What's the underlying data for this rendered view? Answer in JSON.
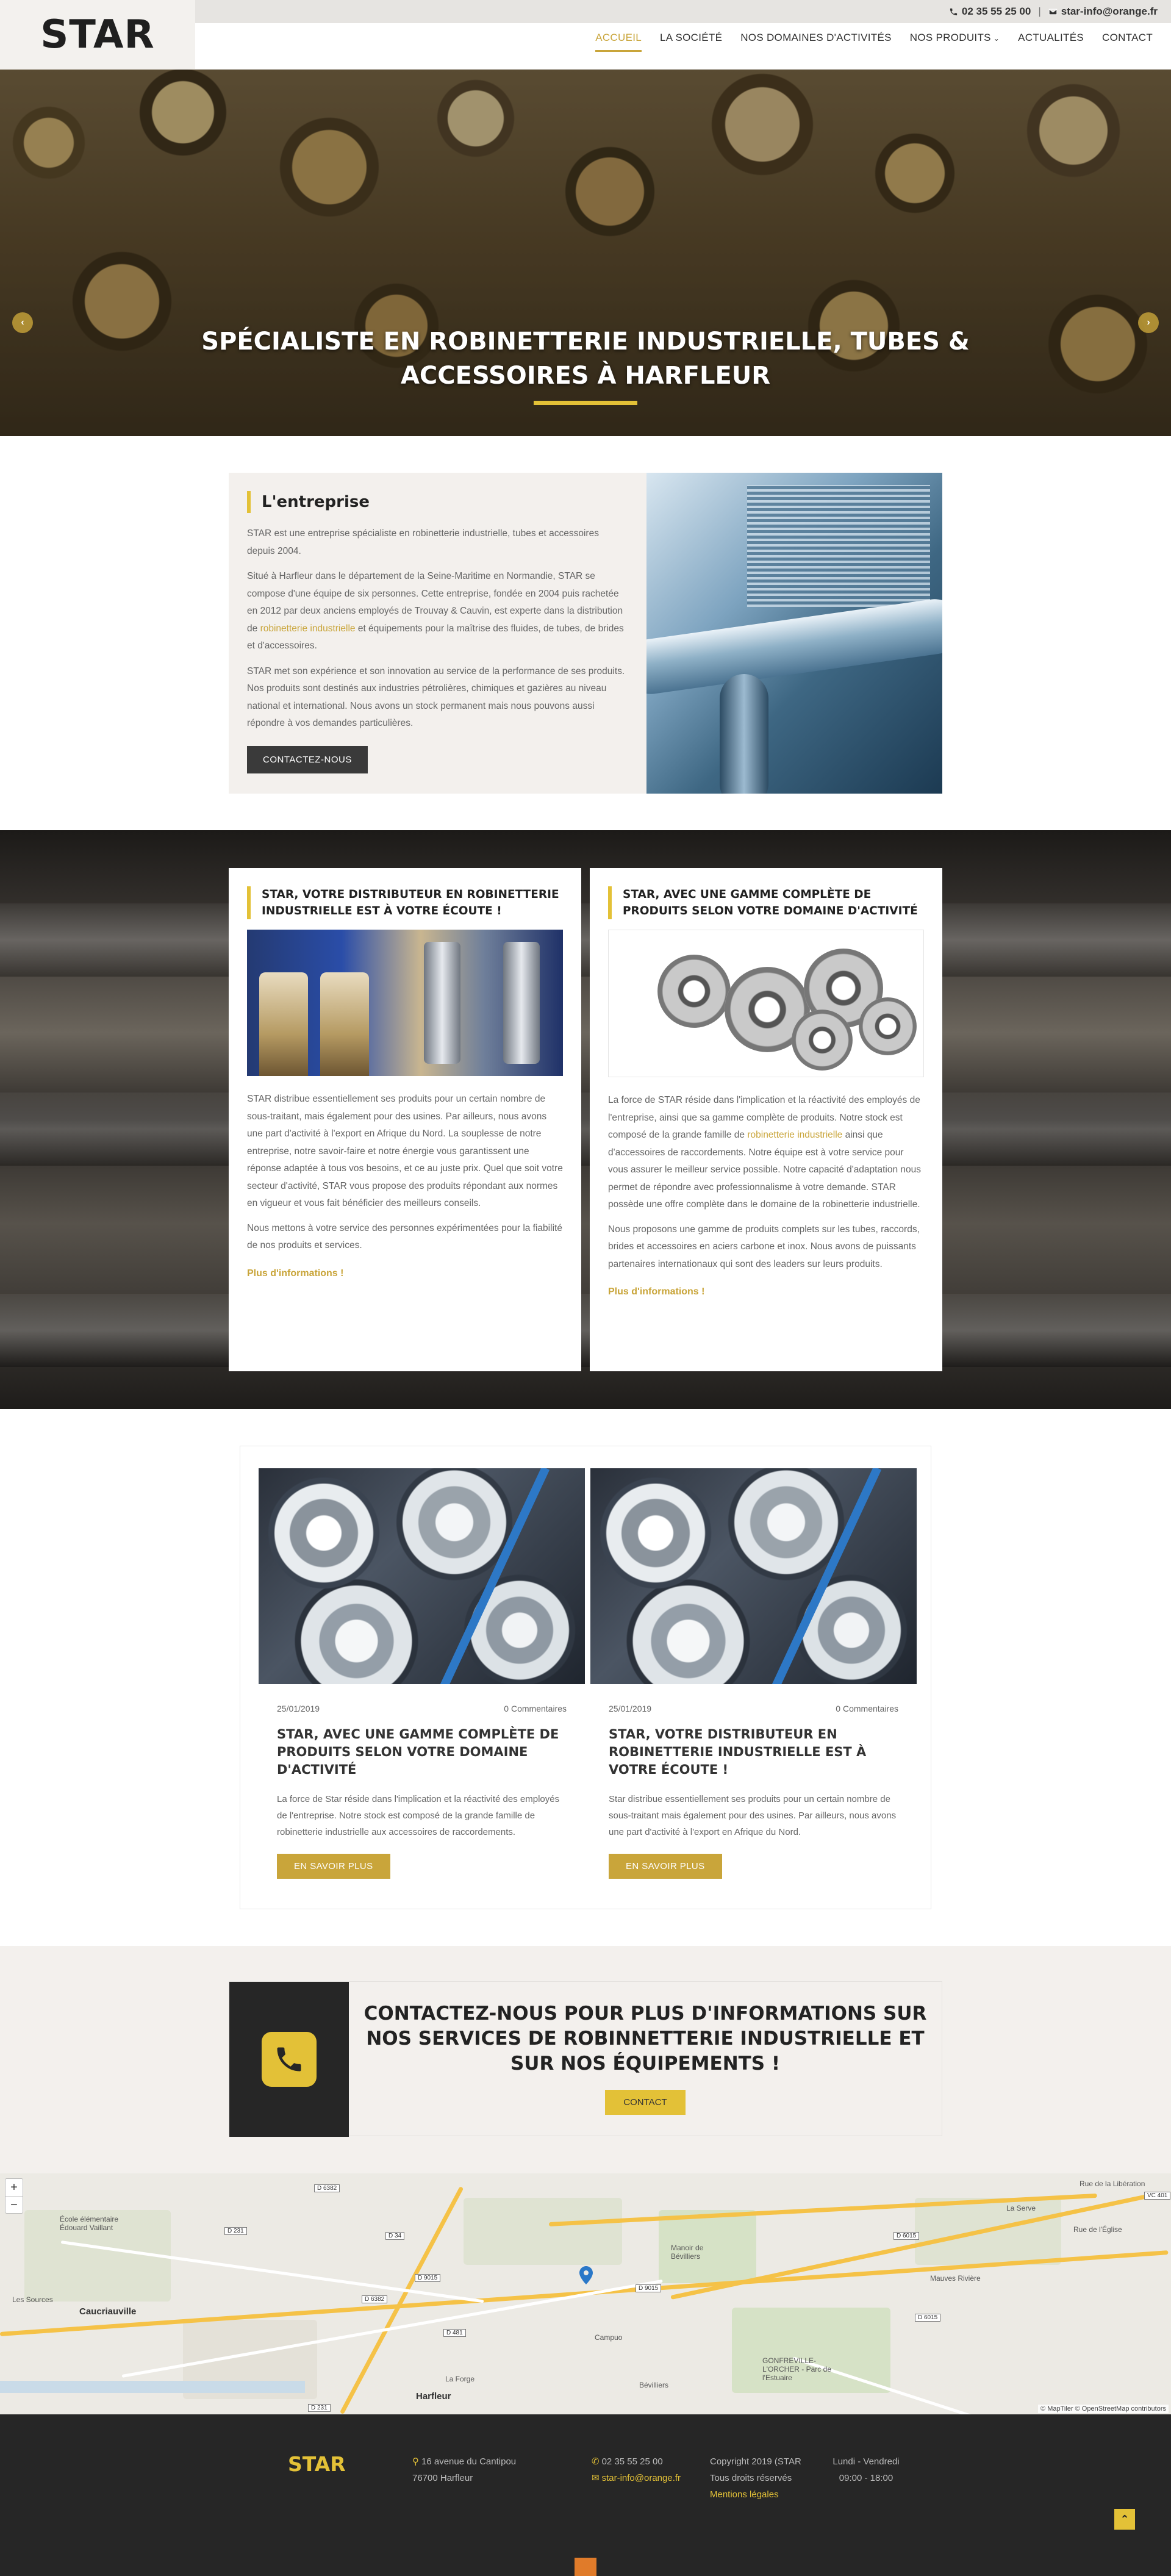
{
  "brand": {
    "logo": "STAR",
    "accent": "#e3c137",
    "gold_text": "#c9a53a",
    "dark": "#262626"
  },
  "topbar": {
    "phone": "02 35 55 25 00",
    "separator": "|",
    "email": "star-info@orange.fr"
  },
  "nav": {
    "items": [
      {
        "label": "ACCUEIL",
        "active": true
      },
      {
        "label": "LA SOCIÉTÉ"
      },
      {
        "label": "NOS DOMAINES D'ACTIVITÉS"
      },
      {
        "label": "NOS PRODUITS"
      },
      {
        "label": "ACTUALITÉS"
      },
      {
        "label": "CONTACT"
      }
    ]
  },
  "hero": {
    "title_line1": "SPÉCIALISTE EN ROBINETTERIE INDUSTRIELLE, TUBES &",
    "title_line2": "ACCESSOIRES À HARFLEUR",
    "prev": "‹",
    "next": "›"
  },
  "entreprise": {
    "title": "L'entreprise",
    "p1": "STAR est une entreprise spécialiste en robinetterie industrielle, tubes et accessoires depuis 2004.",
    "p2_a": "Situé à Harfleur dans le département de la Seine-Maritime en Normandie, STAR se compose d'une équipe de six personnes. Cette entreprise, fondée en 2004 puis rachetée en 2012 par deux anciens employés de Trouvay & Cauvin, est experte dans la distribution de ",
    "p2_link": "robinetterie industrielle",
    "p2_b": " et équipements pour la maîtrise des fluides, de tubes, de brides et d'accessoires.",
    "p3": "STAR met son expérience et son innovation au service de la performance de ses produits. Nos produits sont destinés aux industries pétrolières, chimiques et gazières au niveau national et international. Nous avons un stock permanent mais nous pouvons aussi répondre à vos demandes particulières.",
    "button": "CONTACTEZ-NOUS"
  },
  "distrib": {
    "card1": {
      "title": "STAR, VOTRE DISTRIBUTEUR EN ROBINETTERIE INDUSTRIELLE EST À VOTRE ÉCOUTE !",
      "p1": "STAR distribue essentiellement ses produits pour un certain nombre de sous-traitant, mais également pour des usines. Par ailleurs, nous avons une part d'activité à l'export en Afrique du Nord. La souplesse de notre entreprise, notre savoir-faire et notre énergie vous garantissent une réponse adaptée à tous vos besoins, et ce au juste prix. Quel que soit votre secteur d'activité, STAR vous propose des produits répondant aux normes en vigueur et vous fait bénéficier des meilleurs conseils.",
      "p2": "Nous mettons à votre service des personnes expérimentées pour la fiabilité de nos produits et services.",
      "more": "Plus d'informations !"
    },
    "card2": {
      "title": "STAR, AVEC UNE GAMME COMPLÈTE DE PRODUITS SELON VOTRE DOMAINE D'ACTIVITÉ",
      "p1_a": "La force de STAR réside dans l'implication et la réactivité des employés de l'entreprise, ainsi que sa gamme complète de produits. Notre stock est composé de la grande famille de ",
      "p1_link": "robinetterie industrielle",
      "p1_b": " ainsi que d'accessoires de raccordements. Notre équipe est à votre service pour vous assurer le meilleur service possible. Notre capacité d'adaptation nous permet de répondre avec professionnalisme à votre demande. STAR possède une offre complète dans le domaine de la robinetterie industrielle.",
      "p2": "Nous proposons une gamme de produits complets sur les tubes, raccords, brides et accessoires en aciers carbone et inox. Nous avons de puissants partenaires internationaux qui sont des leaders sur leurs produits.",
      "more": "Plus d'informations !"
    }
  },
  "blog": {
    "posts": [
      {
        "date": "25/01/2019",
        "comments": "0 Commentaires",
        "title": "STAR, AVEC UNE GAMME COMPLÈTE DE PRODUITS SELON VOTRE DOMAINE D'ACTIVITÉ",
        "excerpt": "La force de Star réside dans l'implication et la réactivité des employés de l'entreprise. Notre stock est composé de la grande famille de robinetterie industrielle aux accessoires de raccordements.",
        "button": "EN SAVOIR PLUS"
      },
      {
        "date": "25/01/2019",
        "comments": "0 Commentaires",
        "title": "STAR, VOTRE DISTRIBUTEUR EN ROBINETTERIE INDUSTRIELLE EST À VOTRE ÉCOUTE !",
        "excerpt": "Star distribue essentiellement ses produits pour un certain nombre de sous-traitant mais également pour des usines. Par ailleurs, nous avons une part d'activité à l'export en Afrique du Nord.",
        "button": "EN SAVOIR PLUS"
      }
    ]
  },
  "cta": {
    "title": "CONTACTEZ-NOUS POUR PLUS D'INFORMATIONS SUR NOS SERVICES DE ROBINNETTERIE INDUSTRIELLE ET SUR NOS ÉQUIPEMENTS !",
    "button": "CONTACT"
  },
  "map": {
    "zoom_in": "+",
    "zoom_out": "−",
    "labels": {
      "harfleur": "Harfleur",
      "caucriauville": "Caucriauville",
      "ecole": "École élémentaire Édouard Vaillant",
      "lesoures": "Les Sources",
      "campuo": "Campuo",
      "manoir": "Manoir de Bévilliers",
      "gonfreville": "GONFREVILLE-L'ORCHER - Parc de l'Estuaire",
      "laforge": "La Forge",
      "mayville": "Mauves Rivière",
      "leserve": "La Serve",
      "beviliers": "Bévilliers",
      "route_liberation": "Rue de la Libération",
      "eglise": "Rue de l'Église"
    },
    "roads": [
      "D 6382",
      "D 231",
      "D 34",
      "D 9015",
      "D 6382",
      "D 481",
      "D 6015",
      "D 9015",
      "D 231",
      "VC 401",
      "D 6015"
    ],
    "attribution": "© MapTiler © OpenStreetMap contributors"
  },
  "footer": {
    "logo": "STAR",
    "address1": "16 avenue du Cantipou",
    "address2": "76700 Harfleur",
    "phone": "02 35 55 25 00",
    "email": "star-info@orange.fr",
    "copy1": "Copyright 2019 (STAR",
    "copy2": "Tous droits réservés",
    "legal": "Mentions légales",
    "hours1": "Lundi - Vendredi",
    "hours2": "09:00 - 18:00",
    "totop": "⌃"
  }
}
